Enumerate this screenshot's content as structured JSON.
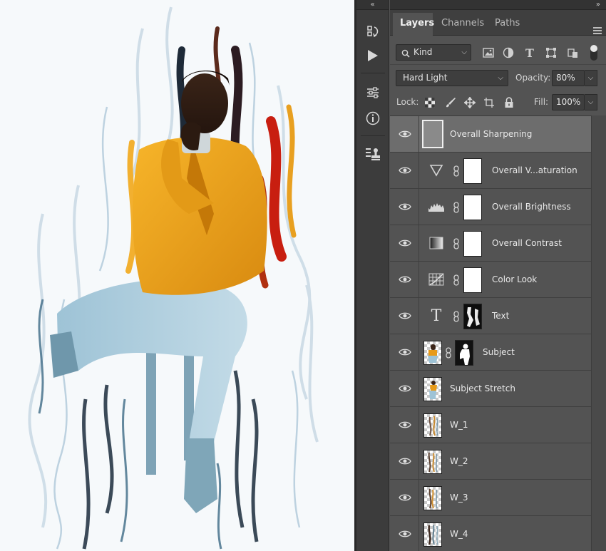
{
  "panel": {
    "tabs": [
      {
        "label": "Layers"
      },
      {
        "label": "Channels"
      },
      {
        "label": "Paths"
      }
    ]
  },
  "filter": {
    "kind_label": "Kind"
  },
  "blend": {
    "mode": "Hard Light",
    "opacity_label": "Opacity:",
    "opacity_value": "80%",
    "lock_label": "Lock:",
    "fill_label": "Fill:",
    "fill_value": "100%"
  },
  "layers": [
    {
      "name": "Overall Sharpening",
      "selected": true
    },
    {
      "name": "Overall V...aturation"
    },
    {
      "name": "Overall Brightness"
    },
    {
      "name": "Overall Contrast"
    },
    {
      "name": "Color Look"
    },
    {
      "name": "Text"
    },
    {
      "name": "Subject"
    },
    {
      "name": "Subject Stretch"
    },
    {
      "name": "W_1"
    },
    {
      "name": "W_2"
    },
    {
      "name": "W_3"
    },
    {
      "name": "W_4"
    }
  ],
  "colors": {
    "panel_bg": "#535353",
    "selected_row": "#6d6d6d",
    "jacket_orange": "#f0a21a",
    "pants_blue": "#a9cde0"
  }
}
